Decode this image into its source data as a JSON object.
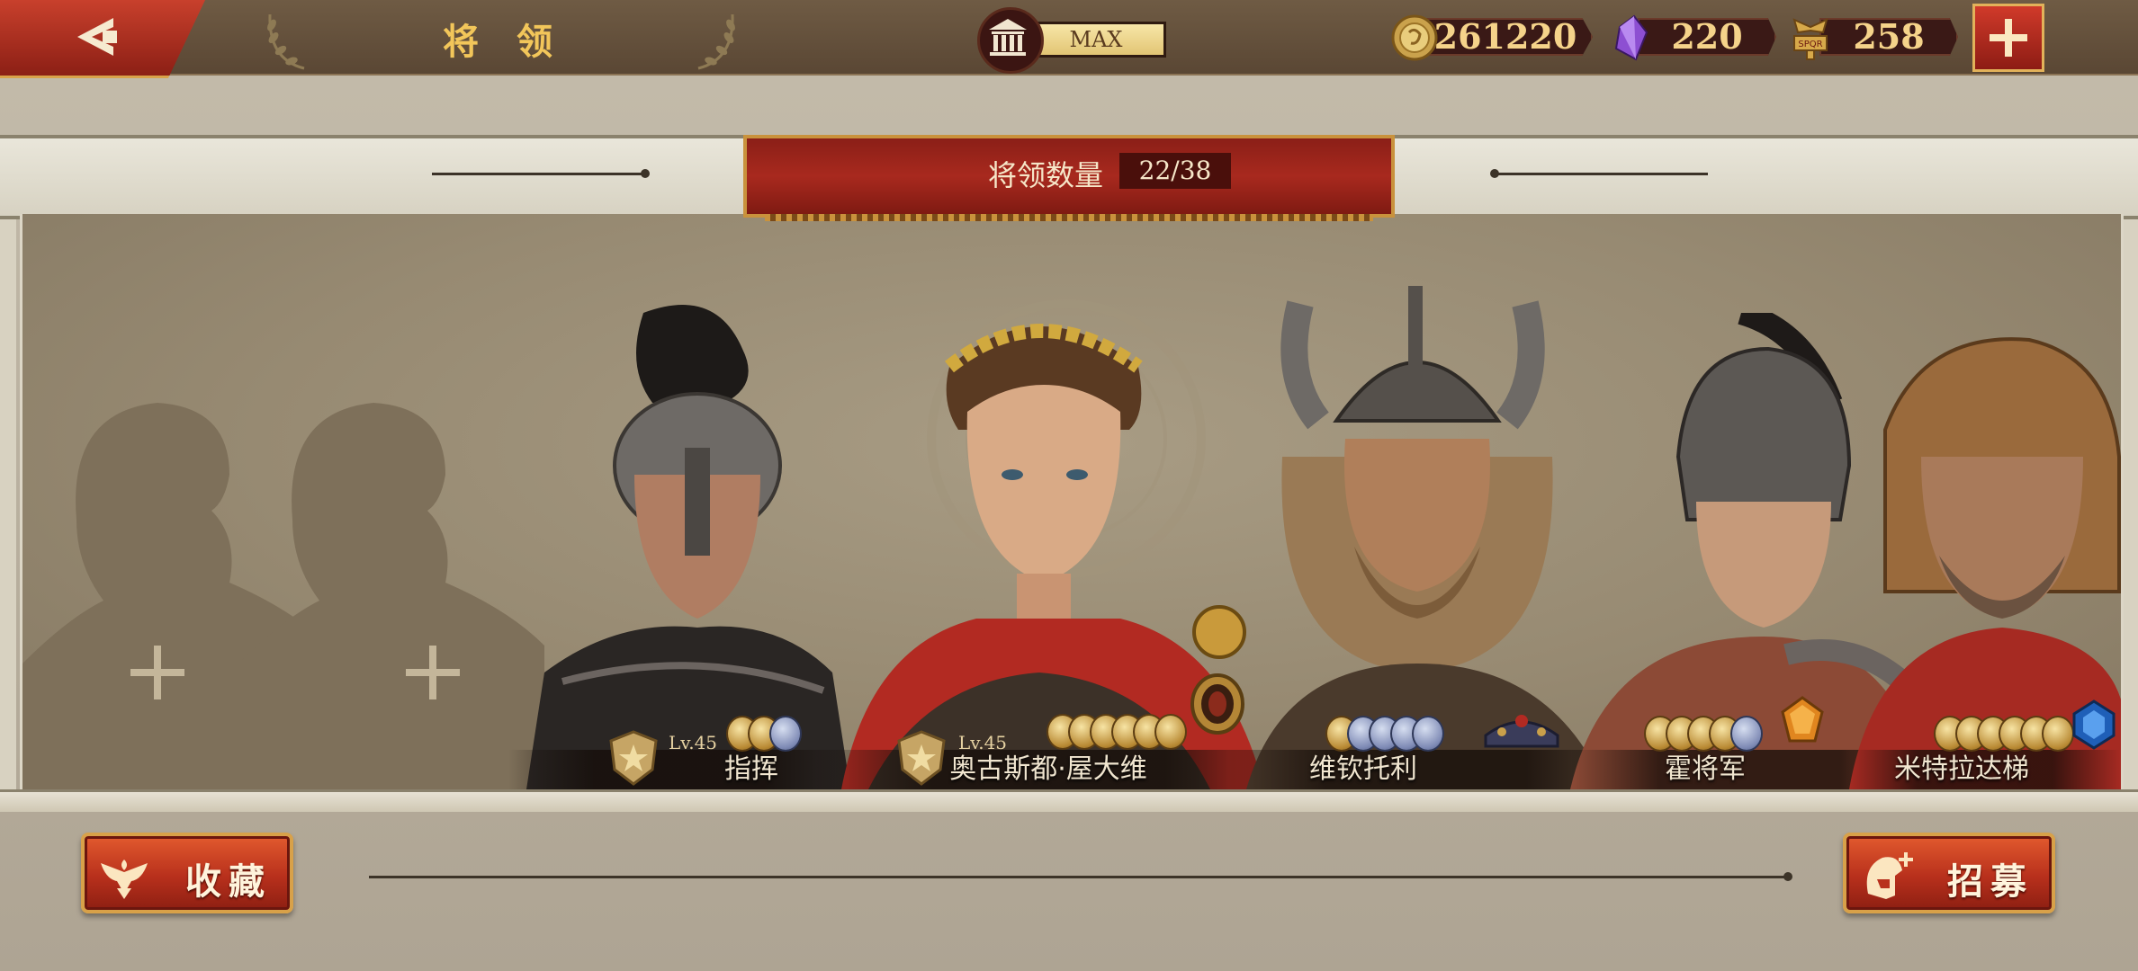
{
  "header": {
    "title": "将 领",
    "building_level": "MAX",
    "resources": [
      {
        "name": "gold-coin-icon",
        "value": "261220"
      },
      {
        "name": "purple-gem-icon",
        "value": "220"
      },
      {
        "name": "spqr-emblem-icon",
        "value": "258"
      }
    ]
  },
  "banner": {
    "label": "将领数量",
    "count": "22/38"
  },
  "heroes": [
    {
      "name": "指挥",
      "level": "Lv.45"
    },
    {
      "name": "奥古斯都·屋大维",
      "level": "Lv.45"
    },
    {
      "name": "维钦托利",
      "level": ""
    },
    {
      "name": "霍将军",
      "level": ""
    },
    {
      "name": "米特拉达梯",
      "level": ""
    }
  ],
  "buttons": {
    "collection": "收藏",
    "recruit": "招募"
  },
  "colors": {
    "accent_red": "#a8291e",
    "gold_text": "#f2c65a",
    "frame_brown": "#5a4734"
  }
}
